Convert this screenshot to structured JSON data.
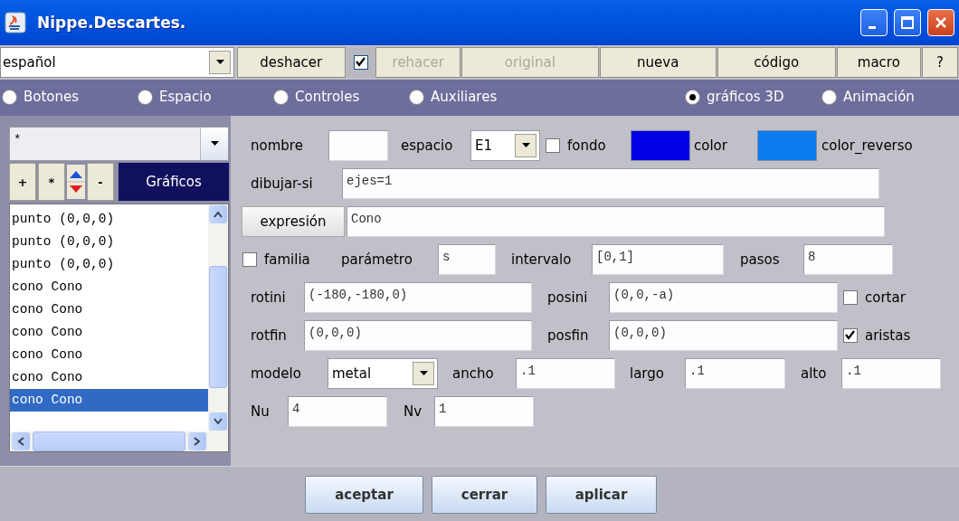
{
  "window": {
    "title": "Nippe.Descartes."
  },
  "toolbar": {
    "language": "español",
    "items": [
      {
        "kind": "button",
        "label": "deshacer",
        "disabled": false
      },
      {
        "kind": "checkbox",
        "checked": true
      },
      {
        "kind": "button",
        "label": "rehacer",
        "disabled": true
      },
      {
        "kind": "button",
        "label": "original",
        "disabled": true
      },
      {
        "kind": "button",
        "label": "nueva",
        "disabled": false
      },
      {
        "kind": "button",
        "label": "código",
        "disabled": false
      },
      {
        "kind": "button",
        "label": "macro",
        "disabled": false
      },
      {
        "kind": "button",
        "label": "?",
        "disabled": false
      }
    ]
  },
  "tabs": [
    {
      "label": "Botones",
      "selected": false
    },
    {
      "label": "Espacio",
      "selected": false
    },
    {
      "label": "Controles",
      "selected": false
    },
    {
      "label": "Auxiliares",
      "selected": false
    },
    {
      "label": "gráficos 3D",
      "selected": true
    },
    {
      "label": "Animación",
      "selected": false
    }
  ],
  "objects": {
    "filter": "*",
    "buttons": [
      "+",
      "*",
      "-"
    ],
    "heading": "Gráficos",
    "items": [
      {
        "label": "punto (0,0,0)",
        "selected": false
      },
      {
        "label": "punto (0,0,0)",
        "selected": false
      },
      {
        "label": "punto (0,0,0)",
        "selected": false
      },
      {
        "label": "cono Cono",
        "selected": false
      },
      {
        "label": "cono Cono",
        "selected": false
      },
      {
        "label": "cono Cono",
        "selected": false
      },
      {
        "label": "cono Cono",
        "selected": false
      },
      {
        "label": "cono Cono",
        "selected": false
      },
      {
        "label": "cono Cono",
        "selected": true
      }
    ]
  },
  "editor": {
    "rows": [
      {
        "items": [
          {
            "kind": "label",
            "text": "nombre"
          },
          {
            "kind": "field"
          },
          {
            "kind": "label",
            "text": "espacio"
          },
          {
            "kind": "combo",
            "value": "E1"
          },
          {
            "kind": "checkbox",
            "label": "fondo",
            "checked": false
          },
          {
            "kind": "color",
            "color": "#0000e6"
          },
          {
            "kind": "label",
            "text": "color"
          },
          {
            "kind": "color",
            "color": "#0a7cf0"
          },
          {
            "kind": "label",
            "text": "color_reverso"
          }
        ]
      },
      {
        "items": [
          {
            "kind": "label",
            "text": "dibujar-si"
          },
          {
            "kind": "field",
            "value": "ejes=1"
          }
        ]
      },
      {
        "items": [
          {
            "kind": "button",
            "text": "expresión"
          },
          {
            "kind": "field",
            "value": "Cono"
          }
        ]
      },
      {
        "items": [
          {
            "kind": "checkbox",
            "label": "familia",
            "checked": false
          },
          {
            "kind": "label",
            "text": "parámetro"
          },
          {
            "kind": "field",
            "value": "s"
          },
          {
            "kind": "label",
            "text": "intervalo"
          },
          {
            "kind": "field",
            "value": "[0,1]"
          },
          {
            "kind": "label",
            "text": "pasos"
          },
          {
            "kind": "field",
            "value": "8"
          }
        ]
      },
      {
        "items": [
          {
            "kind": "label",
            "text": "rotini"
          },
          {
            "kind": "field",
            "value": "(-180,-180,0)"
          },
          {
            "kind": "label",
            "text": "posini"
          },
          {
            "kind": "field",
            "value": "(0,0,-a)"
          },
          {
            "kind": "checkbox",
            "label": "cortar",
            "checked": false
          }
        ]
      },
      {
        "items": [
          {
            "kind": "label",
            "text": "rotfin"
          },
          {
            "kind": "field",
            "value": "(0,0,0)"
          },
          {
            "kind": "label",
            "text": "posfin"
          },
          {
            "kind": "field",
            "value": "(0,0,0)"
          },
          {
            "kind": "checkbox",
            "label": "aristas",
            "checked": true
          }
        ]
      },
      {
        "items": [
          {
            "kind": "label",
            "text": "modelo"
          },
          {
            "kind": "combo",
            "value": "metal"
          },
          {
            "kind": "label",
            "text": "ancho"
          },
          {
            "kind": "field",
            "value": ".1"
          },
          {
            "kind": "label",
            "text": "largo"
          },
          {
            "kind": "field",
            "value": ".1"
          },
          {
            "kind": "label",
            "text": "alto"
          },
          {
            "kind": "field",
            "value": ".1"
          }
        ]
      },
      {
        "items": [
          {
            "kind": "label",
            "text": "Nu"
          },
          {
            "kind": "field",
            "value": "4"
          },
          {
            "kind": "label",
            "text": "Nv"
          },
          {
            "kind": "field",
            "value": "1"
          }
        ]
      }
    ]
  },
  "footer": {
    "buttons": [
      "aceptar",
      "cerrar",
      "aplicar"
    ]
  }
}
